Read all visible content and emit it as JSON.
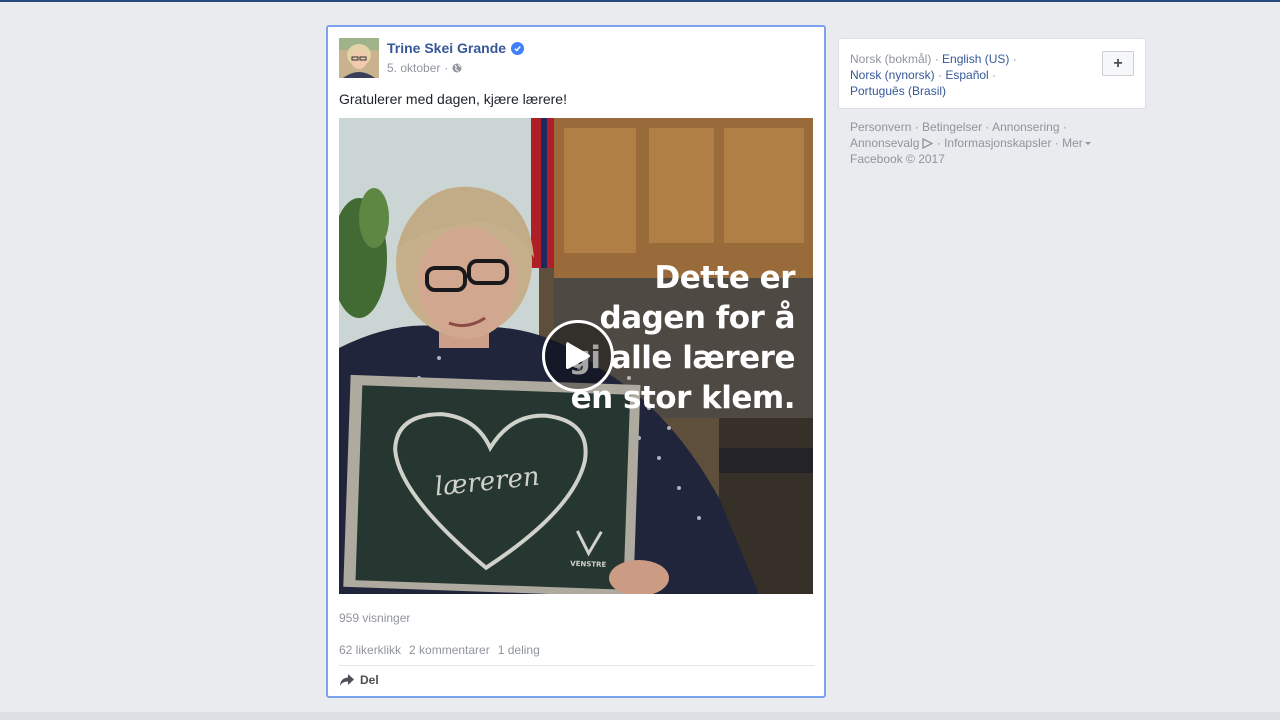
{
  "post": {
    "author": "Trine Skei Grande",
    "date": "5. oktober",
    "separator": "·",
    "text": "Gratulerer med dagen, kjære lærere!",
    "video": {
      "overlay_lines": [
        "Dette er",
        "dagen for å",
        "gi alle lærere",
        "en stor klem."
      ],
      "board_text": "læreren",
      "board_logo_text": "VENSTRE"
    },
    "views": "959 visninger",
    "likes": "62 likerklikk",
    "comments": "2 kommentarer",
    "shares": "1 deling",
    "share_label": "Del"
  },
  "languages": {
    "current": "Norsk (bokmål)",
    "links": [
      "English (US)",
      "Norsk (nynorsk)",
      "Español",
      "Português (Brasil)"
    ],
    "add_label": "+"
  },
  "footer": {
    "links": [
      "Personvern",
      "Betingelser",
      "Annonsering",
      "Annonsevalg",
      "Informasjonskapsler",
      "Mer"
    ],
    "copyright": "Facebook © 2017"
  },
  "colors": {
    "link": "#365899",
    "muted": "#90949c",
    "highlight_border": "#7ea1ee",
    "background": "#e9ebee"
  },
  "icons": [
    "verified-badge-icon",
    "globe-icon",
    "play-icon",
    "share-arrow-icon",
    "adchoices-icon",
    "caret-down-icon"
  ]
}
